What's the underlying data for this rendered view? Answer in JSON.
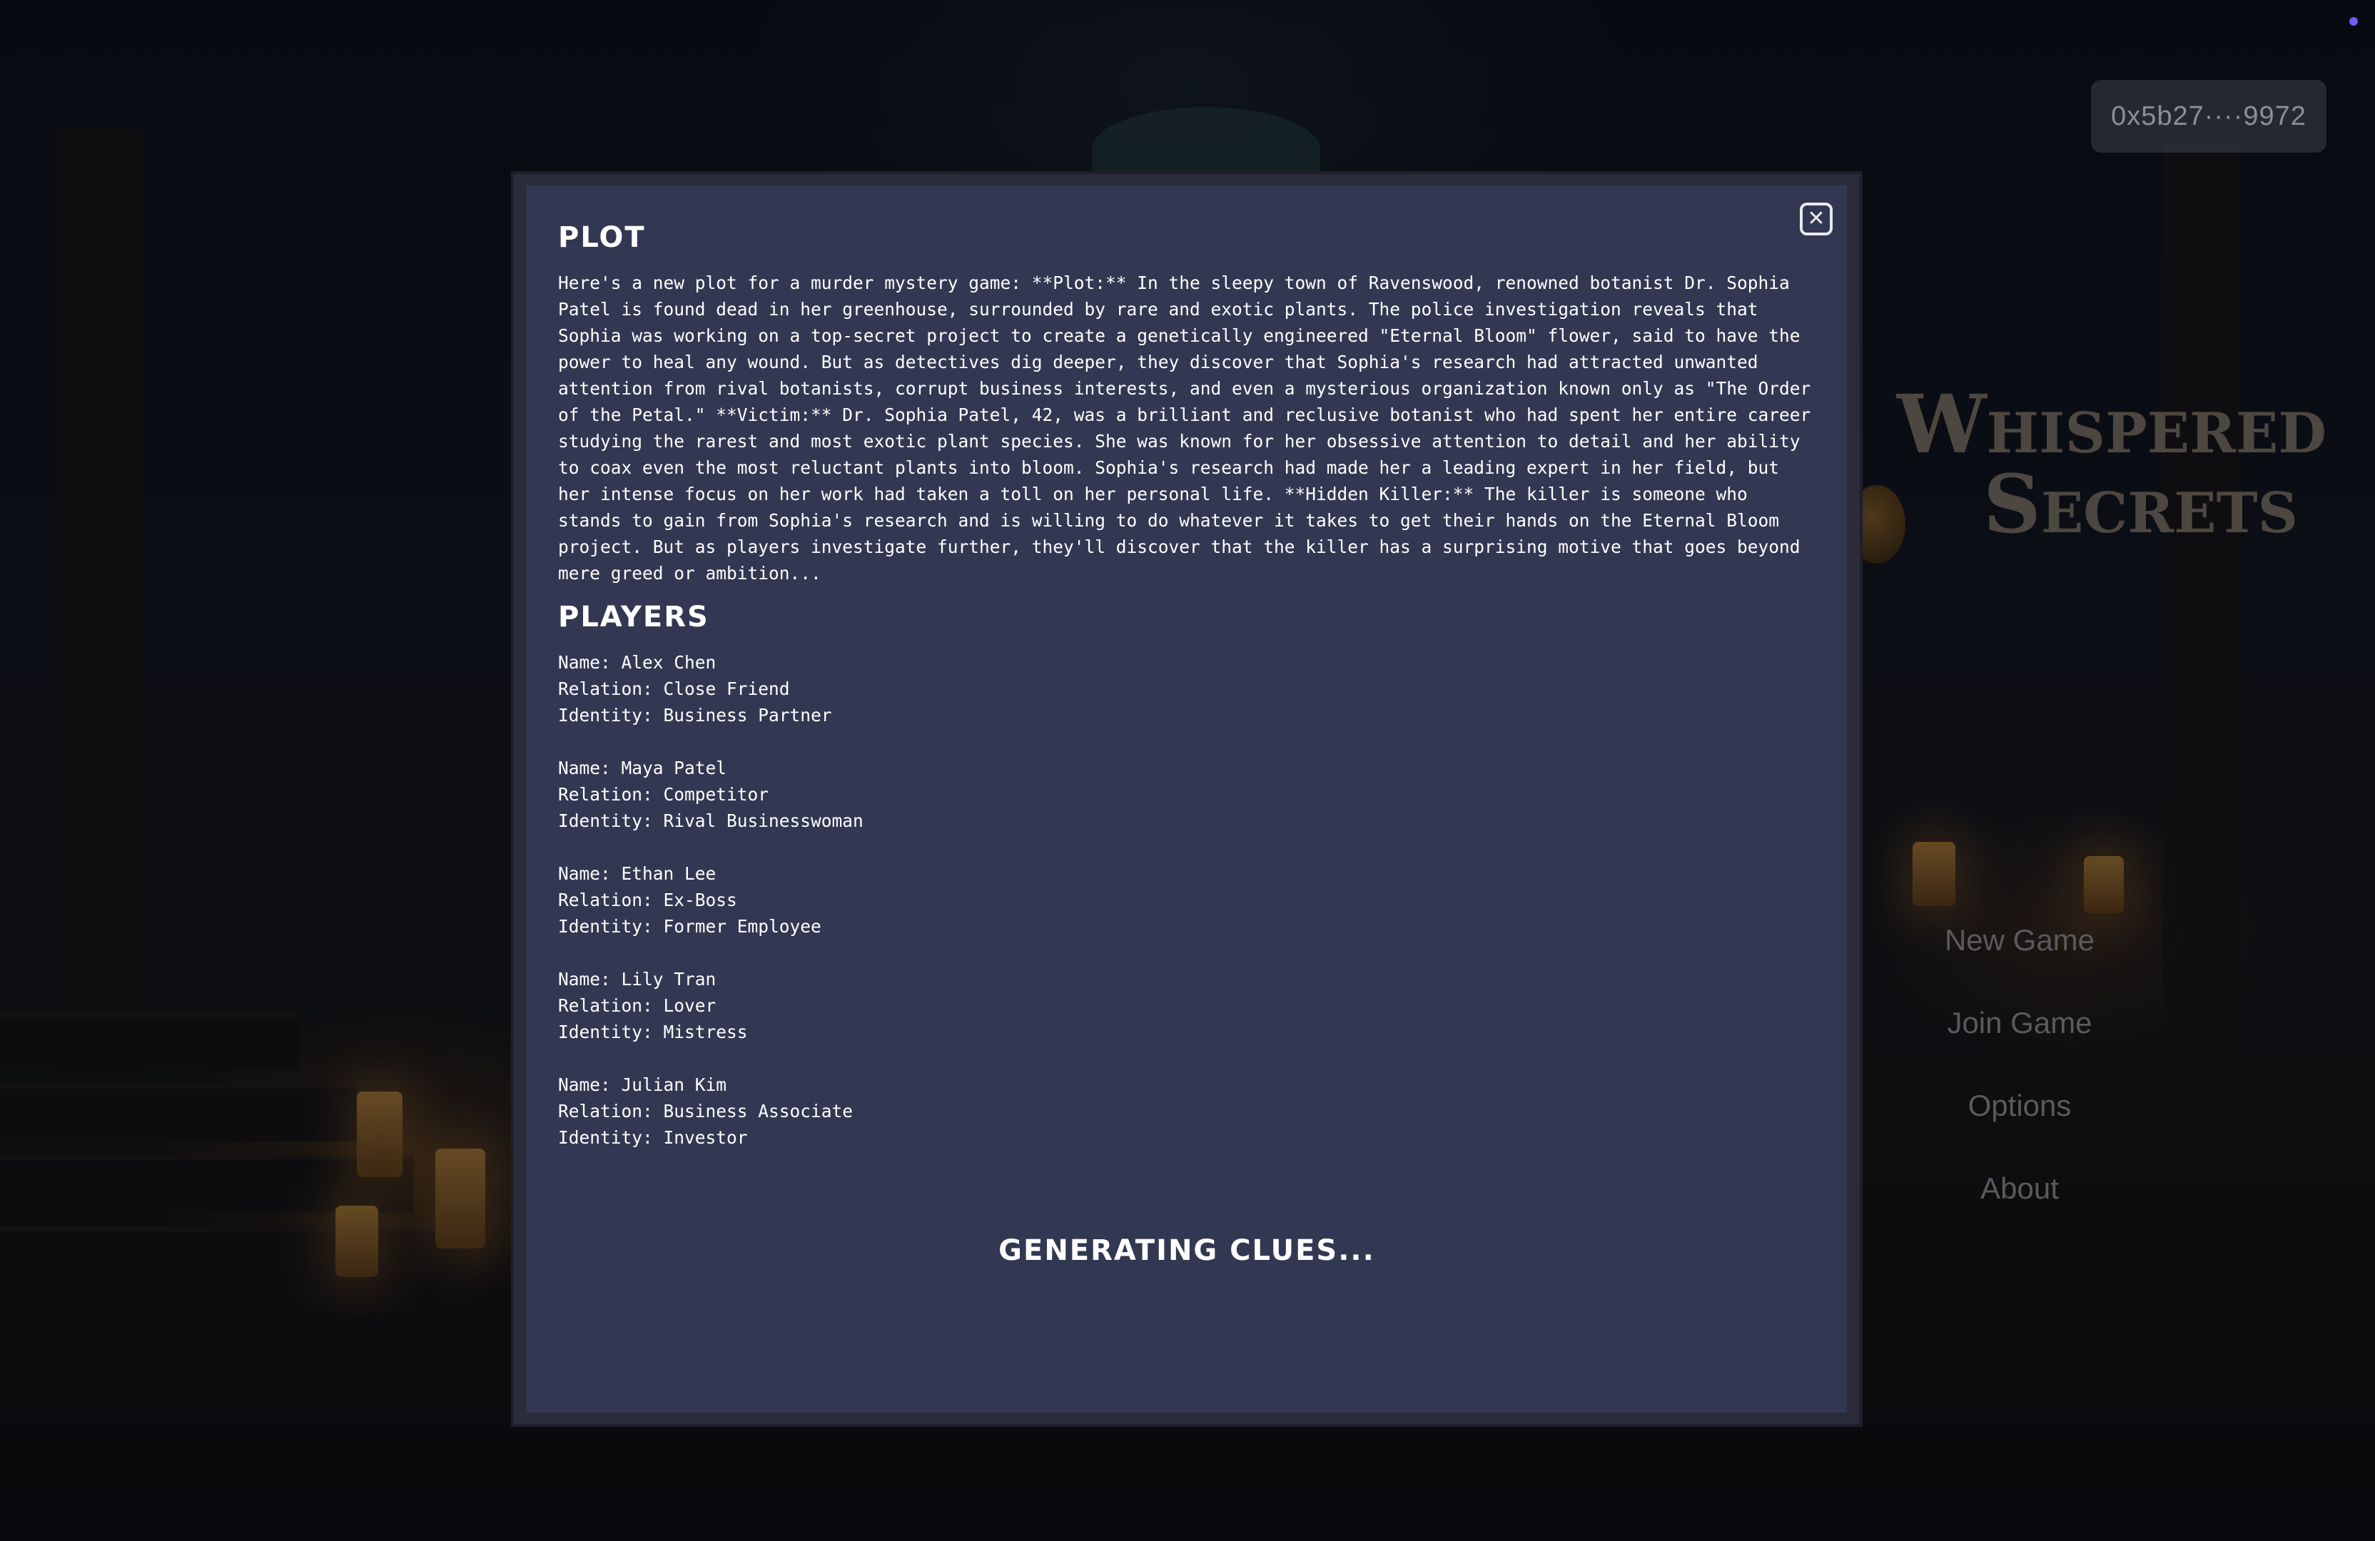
{
  "wallet": {
    "address": "0x5b27····9972"
  },
  "game": {
    "title_line1": "Whispered",
    "title_line2": "Secrets"
  },
  "menu": {
    "items": [
      {
        "label": "New Game"
      },
      {
        "label": "Join Game"
      },
      {
        "label": "Options"
      },
      {
        "label": "About"
      }
    ]
  },
  "modal": {
    "close_icon": "close-icon",
    "plot_heading": "Plot",
    "plot_text": "Here's a new plot for a murder mystery game: **Plot:** In the sleepy town of Ravenswood, renowned botanist Dr. Sophia Patel is found dead in her greenhouse, surrounded by rare and exotic plants. The police investigation reveals that Sophia was working on a top-secret project to create a genetically engineered \"Eternal Bloom\" flower, said to have the power to heal any wound. But as detectives dig deeper, they discover that Sophia's research had attracted unwanted attention from rival botanists, corrupt business interests, and even a mysterious organization known only as \"The Order of the Petal.\" **Victim:** Dr. Sophia Patel, 42, was a brilliant and reclusive botanist who had spent her entire career studying the rarest and most exotic plant species. She was known for her obsessive attention to detail and her ability to coax even the most reluctant plants into bloom. Sophia's research had made her a leading expert in her field, but her intense focus on her work had taken a toll on her personal life. **Hidden Killer:** The killer is someone who stands to gain from Sophia's research and is willing to do whatever it takes to get their hands on the Eternal Bloom project. But as players investigate further, they'll discover that the killer has a surprising motive that goes beyond mere greed or ambition...",
    "players_heading": "Players",
    "players": [
      {
        "name": "Name: Alex Chen",
        "relation": "Relation: Close Friend",
        "identity": "Identity: Business Partner"
      },
      {
        "name": "Name: Maya Patel",
        "relation": "Relation: Competitor",
        "identity": "Identity: Rival Businesswoman"
      },
      {
        "name": "Name: Ethan Lee",
        "relation": "Relation: Ex-Boss",
        "identity": "Identity: Former Employee"
      },
      {
        "name": "Name: Lily Tran",
        "relation": "Relation: Lover",
        "identity": "Identity: Mistress"
      },
      {
        "name": "Name: Julian Kim",
        "relation": "Relation: Business Associate",
        "identity": "Identity: Investor"
      }
    ],
    "status": "Generating clues..."
  },
  "colors": {
    "modal_bg": "#323852",
    "modal_frame": "#2b2c3a",
    "status_dot": "#6b5cf5"
  }
}
